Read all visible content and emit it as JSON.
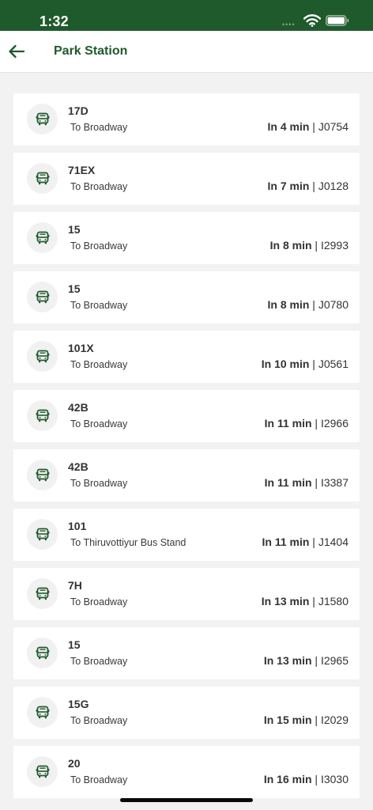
{
  "status": {
    "time": "1:32"
  },
  "header": {
    "title": "Park Station"
  },
  "colors": {
    "brand": "#1f5a2c",
    "background": "#f2f2f2"
  },
  "arrivals": [
    {
      "route": "17D",
      "destination": "To Broadway",
      "eta": "In 4 min",
      "vehicle": "J0754"
    },
    {
      "route": "71EX",
      "destination": "To Broadway",
      "eta": "In 7 min",
      "vehicle": "J0128"
    },
    {
      "route": "15",
      "destination": "To Broadway",
      "eta": "In 8 min",
      "vehicle": "I2993"
    },
    {
      "route": "15",
      "destination": "To Broadway",
      "eta": "In 8 min",
      "vehicle": "J0780"
    },
    {
      "route": "101X",
      "destination": "To Broadway",
      "eta": "In 10 min",
      "vehicle": "J0561"
    },
    {
      "route": "42B",
      "destination": "To Broadway",
      "eta": "In 11 min",
      "vehicle": "I2966"
    },
    {
      "route": "42B",
      "destination": "To Broadway",
      "eta": "In 11 min",
      "vehicle": "I3387"
    },
    {
      "route": "101",
      "destination": "To Thiruvottiyur Bus Stand",
      "eta": "In 11 min",
      "vehicle": "J1404"
    },
    {
      "route": "7H",
      "destination": "To Broadway",
      "eta": "In 13 min",
      "vehicle": "J1580"
    },
    {
      "route": "15",
      "destination": "To Broadway",
      "eta": "In 13 min",
      "vehicle": "I2965"
    },
    {
      "route": "15G",
      "destination": "To Broadway",
      "eta": "In 15 min",
      "vehicle": "I2029"
    },
    {
      "route": "20",
      "destination": "To Broadway",
      "eta": "In 16 min",
      "vehicle": "I3030"
    }
  ]
}
